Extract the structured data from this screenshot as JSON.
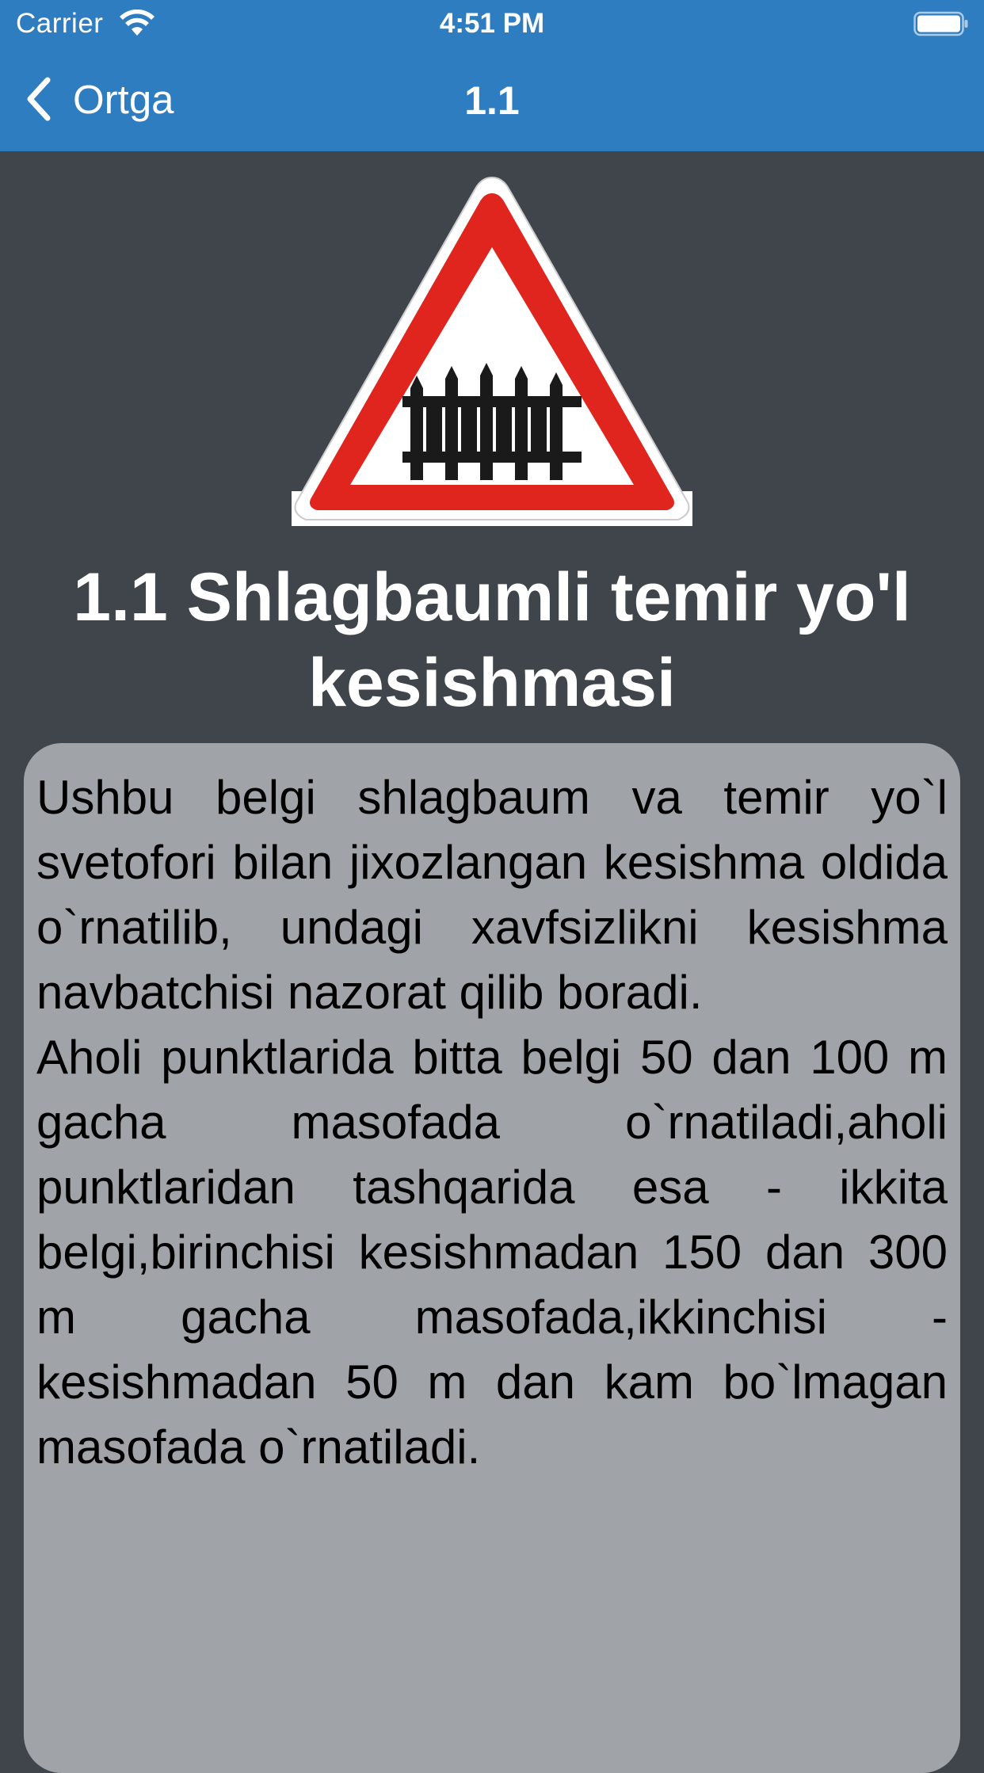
{
  "status_bar": {
    "carrier": "Carrier",
    "time": "4:51 PM",
    "wifi_icon": "wifi-icon",
    "battery_icon": "battery-full-icon"
  },
  "nav": {
    "back_label": "Ortga",
    "back_icon": "chevron-left-icon",
    "title": "1.1"
  },
  "sign": {
    "icon": "railway-crossing-with-barrier-warning-sign",
    "colors": {
      "border": "#e0251e",
      "fill": "#ffffff",
      "symbol": "#1a1a1a"
    },
    "title": "1.1 Shlagbaumli temir yo'l kesishmasi"
  },
  "description": "      Ushbu belgi shlagbaum va temir yo`l svetofori bilan jixozlangan kesishma oldida o`rnatilib, undagi xavfsizlikni kesishma navbatchisi nazorat qilib boradi.\n   Aholi punktlarida bitta belgi 50 dan 100 m gacha masofada o`rnatiladi,aholi punktlaridan tashqarida esa - ikkita belgi,birinchisi kesishmadan 150 dan 300 m gacha masofada,ikkinchisi -kesishmadan 50 m dan kam bo`lmagan masofada o`rnatiladi.",
  "colors": {
    "accent": "#2f7dc1",
    "background": "#40444b",
    "card": "#a0a3a7"
  }
}
